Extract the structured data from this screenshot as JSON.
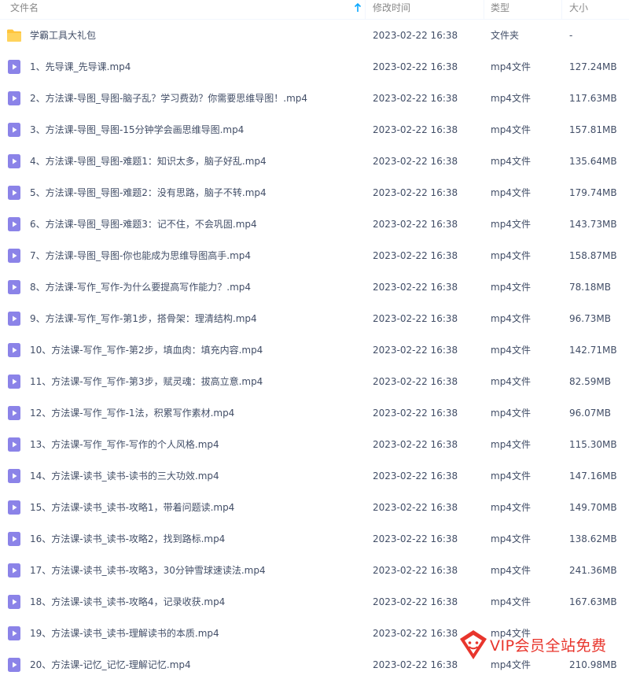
{
  "header": {
    "name": "文件名",
    "modified": "修改时间",
    "type": "类型",
    "size": "大小"
  },
  "files": [
    {
      "name": "学霸工具大礼包",
      "time": "2023-02-22 16:38",
      "type": "文件夹",
      "size": "-",
      "icon": "folder-icon"
    },
    {
      "name": "1、先导课_先导课.mp4",
      "time": "2023-02-22 16:38",
      "type": "mp4文件",
      "size": "127.24MB",
      "icon": "video-icon"
    },
    {
      "name": "2、方法课-导图_导图-脑子乱？学习费劲？你需要思维导图！.mp4",
      "time": "2023-02-22 16:38",
      "type": "mp4文件",
      "size": "117.63MB",
      "icon": "video-icon"
    },
    {
      "name": "3、方法课-导图_导图-15分钟学会画思维导图.mp4",
      "time": "2023-02-22 16:38",
      "type": "mp4文件",
      "size": "157.81MB",
      "icon": "video-icon"
    },
    {
      "name": "4、方法课-导图_导图-难题1：知识太多，脑子好乱.mp4",
      "time": "2023-02-22 16:38",
      "type": "mp4文件",
      "size": "135.64MB",
      "icon": "video-icon"
    },
    {
      "name": "5、方法课-导图_导图-难题2：没有思路，脑子不转.mp4",
      "time": "2023-02-22 16:38",
      "type": "mp4文件",
      "size": "179.74MB",
      "icon": "video-icon"
    },
    {
      "name": "6、方法课-导图_导图-难题3：记不住，不会巩固.mp4",
      "time": "2023-02-22 16:38",
      "type": "mp4文件",
      "size": "143.73MB",
      "icon": "video-icon"
    },
    {
      "name": "7、方法课-导图_导图-你也能成为思维导图高手.mp4",
      "time": "2023-02-22 16:38",
      "type": "mp4文件",
      "size": "158.87MB",
      "icon": "video-icon"
    },
    {
      "name": "8、方法课-写作_写作-为什么要提高写作能力？.mp4",
      "time": "2023-02-22 16:38",
      "type": "mp4文件",
      "size": "78.18MB",
      "icon": "video-icon"
    },
    {
      "name": "9、方法课-写作_写作-第1步，搭骨架：理清结构.mp4",
      "time": "2023-02-22 16:38",
      "type": "mp4文件",
      "size": "96.73MB",
      "icon": "video-icon"
    },
    {
      "name": "10、方法课-写作_写作-第2步，填血肉：填充内容.mp4",
      "time": "2023-02-22 16:38",
      "type": "mp4文件",
      "size": "142.71MB",
      "icon": "video-icon"
    },
    {
      "name": "11、方法课-写作_写作-第3步，赋灵魂：拔高立意.mp4",
      "time": "2023-02-22 16:38",
      "type": "mp4文件",
      "size": "82.59MB",
      "icon": "video-icon"
    },
    {
      "name": "12、方法课-写作_写作-1法，积累写作素材.mp4",
      "time": "2023-02-22 16:38",
      "type": "mp4文件",
      "size": "96.07MB",
      "icon": "video-icon"
    },
    {
      "name": "13、方法课-写作_写作-写作的个人风格.mp4",
      "time": "2023-02-22 16:38",
      "type": "mp4文件",
      "size": "115.30MB",
      "icon": "video-icon"
    },
    {
      "name": "14、方法课-读书_读书-读书的三大功效.mp4",
      "time": "2023-02-22 16:38",
      "type": "mp4文件",
      "size": "147.16MB",
      "icon": "video-icon"
    },
    {
      "name": "15、方法课-读书_读书-攻略1，带着问题读.mp4",
      "time": "2023-02-22 16:38",
      "type": "mp4文件",
      "size": "149.70MB",
      "icon": "video-icon"
    },
    {
      "name": "16、方法课-读书_读书-攻略2，找到路标.mp4",
      "time": "2023-02-22 16:38",
      "type": "mp4文件",
      "size": "138.62MB",
      "icon": "video-icon"
    },
    {
      "name": "17、方法课-读书_读书-攻略3，30分钟雪球速读法.mp4",
      "time": "2023-02-22 16:38",
      "type": "mp4文件",
      "size": "241.36MB",
      "icon": "video-icon"
    },
    {
      "name": "18、方法课-读书_读书-攻略4，记录收获.mp4",
      "time": "2023-02-22 16:38",
      "type": "mp4文件",
      "size": "167.63MB",
      "icon": "video-icon"
    },
    {
      "name": "19、方法课-读书_读书-理解读书的本质.mp4",
      "time": "2023-02-22 16:38",
      "type": "mp4文件",
      "size": "",
      "icon": "video-icon"
    },
    {
      "name": "20、方法课-记忆_记忆-理解记忆.mp4",
      "time": "2023-02-22 16:38",
      "type": "mp4文件",
      "size": "210.98MB",
      "icon": "video-icon"
    }
  ],
  "watermark": {
    "text": "VIP会员全站免费"
  },
  "colors": {
    "folder": "#ffc53d",
    "video": "#8b83e8",
    "sort_arrow": "#06a7ff",
    "watermark": "#e8352c"
  }
}
